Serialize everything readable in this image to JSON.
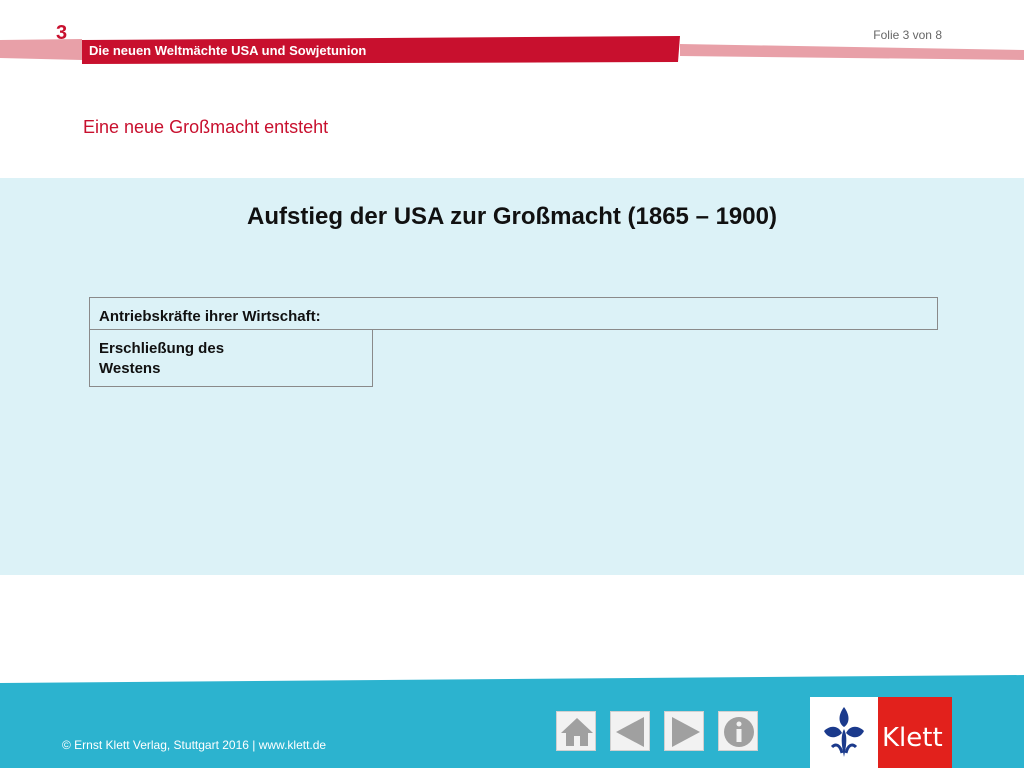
{
  "header": {
    "chapter_number": "3",
    "chapter_title": "Die neuen Weltmächte USA und Sowjetunion",
    "slide_counter": "Folie 3 von 8"
  },
  "slide": {
    "subtitle": "Eine neue Großmacht entsteht",
    "title": "Aufstieg der USA zur Großmacht (1865 – 1900)",
    "table": {
      "header": "Antriebskräfte ihrer Wirtschaft:",
      "cell_line1": "Erschließung des",
      "cell_line2": "Westens"
    }
  },
  "footer": {
    "copyright": "© Ernst Klett Verlag, Stuttgart 2016 | www.klett.de",
    "nav": [
      "home-icon",
      "arrow-left-icon",
      "arrow-right-icon",
      "info-icon"
    ],
    "logo_text": "Klett"
  },
  "colors": {
    "accent_red": "#c8102e",
    "content_bg": "#dcf2f7",
    "footer_bg": "#2cb3cf",
    "logo_red": "#e2211c"
  }
}
